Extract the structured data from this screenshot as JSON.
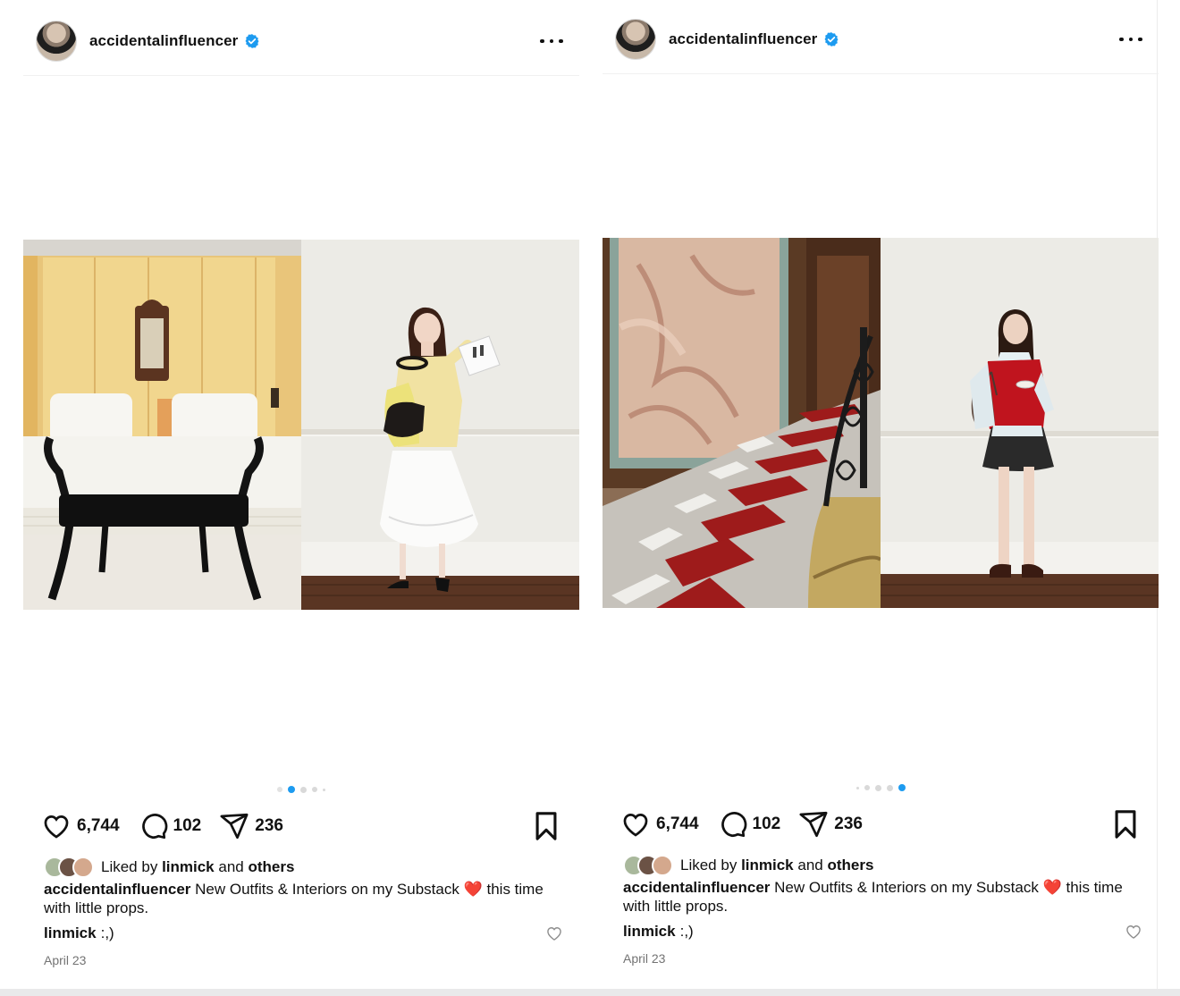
{
  "colors": {
    "accent": "#1d9bf0",
    "heart_red": "#e0245e",
    "muted": "#737373"
  },
  "posts": [
    {
      "username": "accidentalinfluencer",
      "likes": "6,744",
      "comments": "102",
      "shares": "236",
      "liked_prefix": "Liked by",
      "liked_user": "linmick",
      "liked_and": "and",
      "liked_others": "others",
      "caption_user": "accidentalinfluencer",
      "caption_text": "New Outfits & Interiors on my Substack",
      "caption_emoji": "❤️",
      "caption_end": "this time with little props.",
      "comment_user": "linmick",
      "comment_text": ":,)",
      "date": "April 23",
      "carousel_active_index": 1,
      "carousel_count": 5,
      "icons": [
        "more-icon",
        "heart-icon",
        "comment-icon",
        "share-icon",
        "bookmark-icon",
        "verified-badge-icon"
      ]
    },
    {
      "username": "accidentalinfluencer",
      "likes": "6,744",
      "comments": "102",
      "shares": "236",
      "liked_prefix": "Liked by",
      "liked_user": "linmick",
      "liked_and": "and",
      "liked_others": "others",
      "caption_user": "accidentalinfluencer",
      "caption_text": "New Outfits & Interiors on my Substack",
      "caption_emoji": "❤️",
      "caption_end": "this time with little props.",
      "comment_user": "linmick",
      "comment_text": ":,)",
      "date": "April 23",
      "carousel_active_index": 4,
      "carousel_count": 5,
      "icons": [
        "more-icon",
        "heart-icon",
        "comment-icon",
        "share-icon",
        "bookmark-icon",
        "verified-badge-icon"
      ]
    }
  ]
}
